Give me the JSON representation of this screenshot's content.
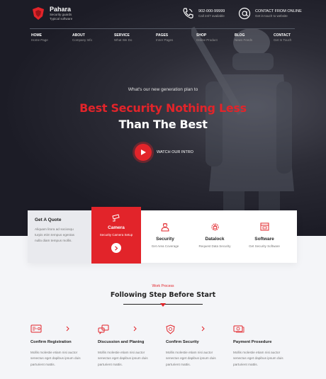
{
  "brand": {
    "name": "Pahara",
    "tagline_1": "Security guards",
    "tagline_2": "Typical software"
  },
  "contact": {
    "phone_title": "902-000-99999",
    "phone_sub": "Call 24/7 available",
    "mail_title": "CONTACT FROM ONLINE",
    "mail_sub": "Get in touch to website"
  },
  "nav": [
    {
      "label": "HOME",
      "sub": "Home Page"
    },
    {
      "label": "ABOUT",
      "sub": "Company Info"
    },
    {
      "label": "SERVICE",
      "sub": "What We Do"
    },
    {
      "label": "PAGES",
      "sub": "Inner Pages"
    },
    {
      "label": "SHOP",
      "sub": "Online Product"
    },
    {
      "label": "BLOG",
      "sub": "News Feeds"
    },
    {
      "label": "CONTACT",
      "sub": "Get In Touch"
    }
  ],
  "hero": {
    "kicker": "What's our new generation plan to",
    "line1": "Best Security Nothing Less",
    "line2": "Than The Best",
    "video_label": "WATCH OUR INTRO"
  },
  "quote": {
    "title": "Get A Quote",
    "lines": [
      "Aliquam litora ad sociosqu",
      "turpis etim tempus egestas",
      "nulla diam tempus mollis."
    ]
  },
  "services": [
    {
      "title": "Camera",
      "sub": "Security Camera Setup",
      "icon": "camera-icon",
      "active": true
    },
    {
      "title": "Security",
      "sub": "Get Area Coverage",
      "icon": "guard-icon"
    },
    {
      "title": "Datalock",
      "sub": "Request Data Security",
      "icon": "gear-lock-icon"
    },
    {
      "title": "Software",
      "sub": "Get Security Software",
      "icon": "software-icon"
    }
  ],
  "work_process": {
    "kicker": "Work Process",
    "title": "Following Step Before Start"
  },
  "steps": [
    {
      "title": "Confirm Registration",
      "text": [
        "Mollis molestie etiam nisi auctor",
        "senectus eget dapibus ipsum duis",
        "parturient mattis."
      ],
      "icon": "registration-icon"
    },
    {
      "title": "Discussion and Planing",
      "text": [
        "Mollis molestie etiam nisi auctor",
        "senectus eget dapibus ipsum duis",
        "parturient mattis."
      ],
      "icon": "discussion-icon"
    },
    {
      "title": "Confirm Security",
      "text": [
        "Mollis molestie etiam nisi auctor",
        "senectus eget dapibus ipsum duis",
        "parturient mattis."
      ],
      "icon": "shield-icon"
    },
    {
      "title": "Payment Prosedure",
      "text": [
        "Mollis molestie etiam nisi auctor",
        "senectus eget dapibus ipsum duis",
        "parturient mattis."
      ],
      "icon": "payment-icon"
    }
  ],
  "colors": {
    "accent": "#e2242a",
    "hero_bg": "#1c1c26",
    "card_bg": "#ffffff",
    "page_bg": "#f4f5f8"
  }
}
